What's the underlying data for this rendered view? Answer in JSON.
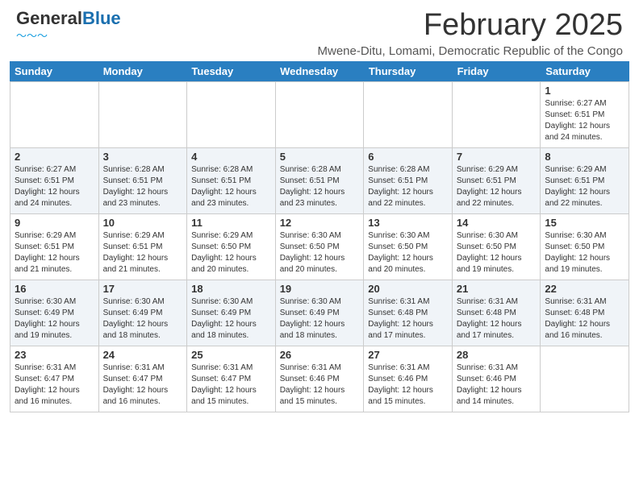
{
  "header": {
    "logo_general": "General",
    "logo_blue": "Blue",
    "month_title": "February 2025",
    "location": "Mwene-Ditu, Lomami, Democratic Republic of the Congo"
  },
  "calendar": {
    "days": [
      "Sunday",
      "Monday",
      "Tuesday",
      "Wednesday",
      "Thursday",
      "Friday",
      "Saturday"
    ],
    "rows": [
      {
        "alt": false,
        "cells": [
          {
            "day": "",
            "info": ""
          },
          {
            "day": "",
            "info": ""
          },
          {
            "day": "",
            "info": ""
          },
          {
            "day": "",
            "info": ""
          },
          {
            "day": "",
            "info": ""
          },
          {
            "day": "",
            "info": ""
          },
          {
            "day": "1",
            "info": "Sunrise: 6:27 AM\nSunset: 6:51 PM\nDaylight: 12 hours and 24 minutes."
          }
        ]
      },
      {
        "alt": true,
        "cells": [
          {
            "day": "2",
            "info": "Sunrise: 6:27 AM\nSunset: 6:51 PM\nDaylight: 12 hours and 24 minutes."
          },
          {
            "day": "3",
            "info": "Sunrise: 6:28 AM\nSunset: 6:51 PM\nDaylight: 12 hours and 23 minutes."
          },
          {
            "day": "4",
            "info": "Sunrise: 6:28 AM\nSunset: 6:51 PM\nDaylight: 12 hours and 23 minutes."
          },
          {
            "day": "5",
            "info": "Sunrise: 6:28 AM\nSunset: 6:51 PM\nDaylight: 12 hours and 23 minutes."
          },
          {
            "day": "6",
            "info": "Sunrise: 6:28 AM\nSunset: 6:51 PM\nDaylight: 12 hours and 22 minutes."
          },
          {
            "day": "7",
            "info": "Sunrise: 6:29 AM\nSunset: 6:51 PM\nDaylight: 12 hours and 22 minutes."
          },
          {
            "day": "8",
            "info": "Sunrise: 6:29 AM\nSunset: 6:51 PM\nDaylight: 12 hours and 22 minutes."
          }
        ]
      },
      {
        "alt": false,
        "cells": [
          {
            "day": "9",
            "info": "Sunrise: 6:29 AM\nSunset: 6:51 PM\nDaylight: 12 hours and 21 minutes."
          },
          {
            "day": "10",
            "info": "Sunrise: 6:29 AM\nSunset: 6:51 PM\nDaylight: 12 hours and 21 minutes."
          },
          {
            "day": "11",
            "info": "Sunrise: 6:29 AM\nSunset: 6:50 PM\nDaylight: 12 hours and 20 minutes."
          },
          {
            "day": "12",
            "info": "Sunrise: 6:30 AM\nSunset: 6:50 PM\nDaylight: 12 hours and 20 minutes."
          },
          {
            "day": "13",
            "info": "Sunrise: 6:30 AM\nSunset: 6:50 PM\nDaylight: 12 hours and 20 minutes."
          },
          {
            "day": "14",
            "info": "Sunrise: 6:30 AM\nSunset: 6:50 PM\nDaylight: 12 hours and 19 minutes."
          },
          {
            "day": "15",
            "info": "Sunrise: 6:30 AM\nSunset: 6:50 PM\nDaylight: 12 hours and 19 minutes."
          }
        ]
      },
      {
        "alt": true,
        "cells": [
          {
            "day": "16",
            "info": "Sunrise: 6:30 AM\nSunset: 6:49 PM\nDaylight: 12 hours and 19 minutes."
          },
          {
            "day": "17",
            "info": "Sunrise: 6:30 AM\nSunset: 6:49 PM\nDaylight: 12 hours and 18 minutes."
          },
          {
            "day": "18",
            "info": "Sunrise: 6:30 AM\nSunset: 6:49 PM\nDaylight: 12 hours and 18 minutes."
          },
          {
            "day": "19",
            "info": "Sunrise: 6:30 AM\nSunset: 6:49 PM\nDaylight: 12 hours and 18 minutes."
          },
          {
            "day": "20",
            "info": "Sunrise: 6:31 AM\nSunset: 6:48 PM\nDaylight: 12 hours and 17 minutes."
          },
          {
            "day": "21",
            "info": "Sunrise: 6:31 AM\nSunset: 6:48 PM\nDaylight: 12 hours and 17 minutes."
          },
          {
            "day": "22",
            "info": "Sunrise: 6:31 AM\nSunset: 6:48 PM\nDaylight: 12 hours and 16 minutes."
          }
        ]
      },
      {
        "alt": false,
        "cells": [
          {
            "day": "23",
            "info": "Sunrise: 6:31 AM\nSunset: 6:47 PM\nDaylight: 12 hours and 16 minutes."
          },
          {
            "day": "24",
            "info": "Sunrise: 6:31 AM\nSunset: 6:47 PM\nDaylight: 12 hours and 16 minutes."
          },
          {
            "day": "25",
            "info": "Sunrise: 6:31 AM\nSunset: 6:47 PM\nDaylight: 12 hours and 15 minutes."
          },
          {
            "day": "26",
            "info": "Sunrise: 6:31 AM\nSunset: 6:46 PM\nDaylight: 12 hours and 15 minutes."
          },
          {
            "day": "27",
            "info": "Sunrise: 6:31 AM\nSunset: 6:46 PM\nDaylight: 12 hours and 15 minutes."
          },
          {
            "day": "28",
            "info": "Sunrise: 6:31 AM\nSunset: 6:46 PM\nDaylight: 12 hours and 14 minutes."
          },
          {
            "day": "",
            "info": ""
          }
        ]
      }
    ]
  }
}
